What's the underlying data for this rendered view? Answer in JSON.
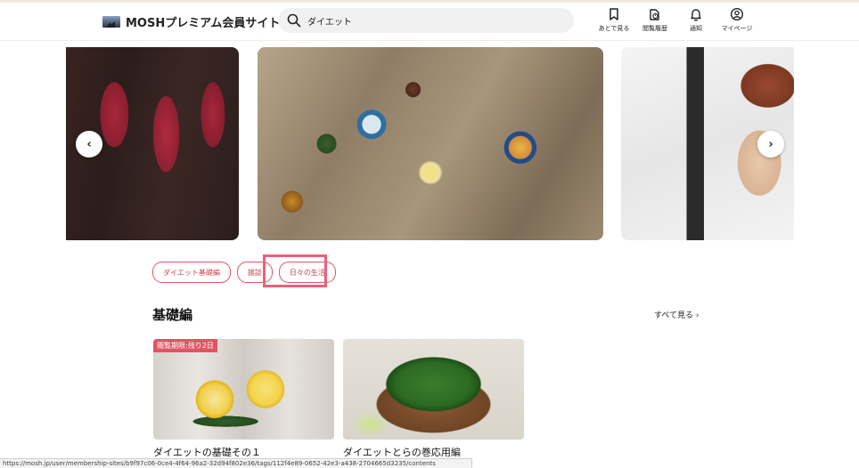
{
  "header": {
    "site_title": "MOSHプレミアム会員サイト",
    "search_value": "ダイエット",
    "nav": [
      {
        "label": "あとで見る",
        "icon": "bookmark-icon"
      },
      {
        "label": "閲覧履歴",
        "icon": "history-icon"
      },
      {
        "label": "通知",
        "icon": "bell-icon"
      },
      {
        "label": "マイページ",
        "icon": "user-icon"
      }
    ]
  },
  "carousel": {
    "prev_label": "‹",
    "next_label": "›",
    "slides": [
      "meat",
      "dining-table",
      "office"
    ]
  },
  "tags": [
    "ダイエット基礎編",
    "雑談",
    "日々の生活"
  ],
  "section": {
    "title": "基礎編",
    "see_all": "すべて見る ›"
  },
  "cards": [
    {
      "badge": "閲覧期限:残り2日",
      "title": "ダイエットの基礎その１"
    },
    {
      "badge": "",
      "title": "ダイエットとらの巻応用編"
    }
  ],
  "status_url": "https://mosh.jp/user/membership-sites/b9f97c06-0ce4-4f64-96a2-32d94f802e36/tags/112f4e89-0652-42e3-a438-2704665d3235/contents",
  "colors": {
    "accent": "#e05562",
    "highlight": "#e8617a"
  }
}
